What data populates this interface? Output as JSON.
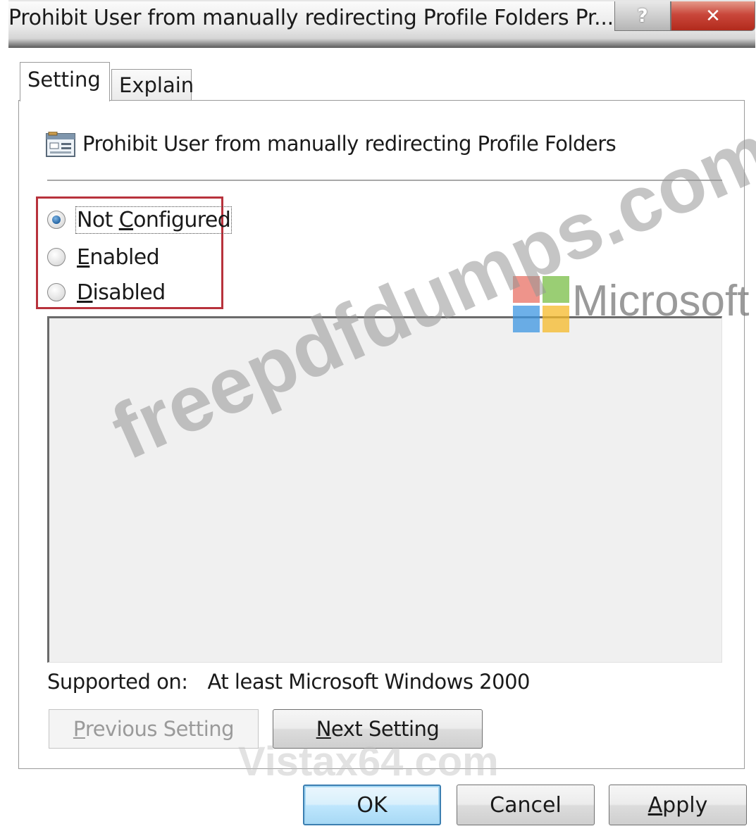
{
  "window": {
    "title": "Prohibit User from manually redirecting Profile Folders Pr...",
    "help_glyph": "?",
    "close_glyph": "✕"
  },
  "tabs": [
    {
      "label": "Setting",
      "active": true
    },
    {
      "label": "Explain",
      "active": false
    }
  ],
  "policy": {
    "icon": "policy-settings-icon",
    "name": "Prohibit User from manually redirecting Profile Folders"
  },
  "options": [
    {
      "pre": "Not ",
      "accel": "C",
      "post": "onfigured",
      "selected": true
    },
    {
      "pre": "",
      "accel": "E",
      "post": "nabled",
      "selected": false
    },
    {
      "pre": "",
      "accel": "D",
      "post": "isabled",
      "selected": false
    }
  ],
  "supported": {
    "label": "Supported on:",
    "value": "At least Microsoft Windows 2000"
  },
  "navigation": {
    "previous": {
      "pre": "",
      "accel": "P",
      "post": "revious Setting",
      "enabled": false
    },
    "next": {
      "pre": "",
      "accel": "N",
      "post": "ext Setting",
      "enabled": true
    }
  },
  "buttons": {
    "ok": "OK",
    "cancel": "Cancel",
    "apply": {
      "pre": "",
      "accel": "A",
      "post": "pply"
    }
  },
  "watermarks": {
    "main": "freepdfdumps.com",
    "logo_text": "Microsoft",
    "bottom": "Vistax64.com"
  },
  "colors": {
    "highlight_border": "#b8323c",
    "ok_border": "#3c7fb1"
  }
}
